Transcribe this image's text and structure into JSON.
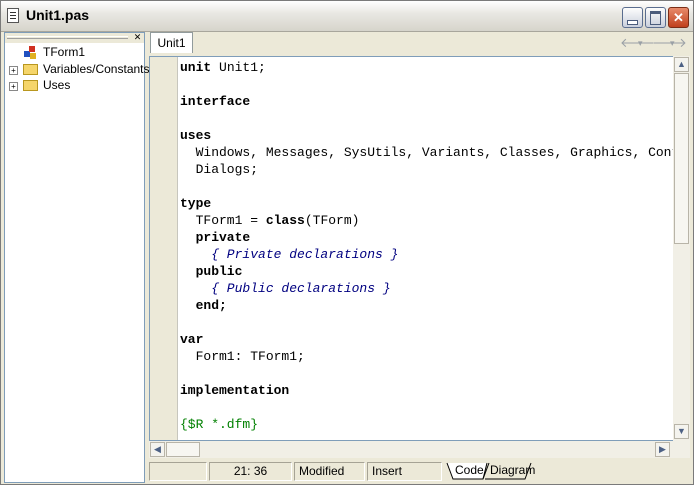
{
  "window": {
    "title": "Unit1.pas"
  },
  "tree": {
    "items": [
      {
        "label": "TForm1",
        "expandable": false,
        "icon": "form-icon"
      },
      {
        "label": "Variables/Constants",
        "expandable": true,
        "icon": "folder-icon"
      },
      {
        "label": "Uses",
        "expandable": true,
        "icon": "folder-icon"
      }
    ]
  },
  "editor": {
    "tab": "Unit1",
    "lines": [
      [
        {
          "t": "unit",
          "c": "kw"
        },
        {
          "t": " Unit1;",
          "c": ""
        }
      ],
      [],
      [
        {
          "t": "interface",
          "c": "kw"
        }
      ],
      [],
      [
        {
          "t": "uses",
          "c": "kw"
        }
      ],
      [
        {
          "t": "  Windows, Messages, SysUtils, Variants, Classes, Graphics, Controls, Forms,",
          "c": ""
        }
      ],
      [
        {
          "t": "  Dialogs;",
          "c": ""
        }
      ],
      [],
      [
        {
          "t": "type",
          "c": "kw"
        }
      ],
      [
        {
          "t": "  TForm1 = ",
          "c": ""
        },
        {
          "t": "class",
          "c": "kw"
        },
        {
          "t": "(TForm)",
          "c": ""
        }
      ],
      [
        {
          "t": "  private",
          "c": "kw"
        }
      ],
      [
        {
          "t": "    { Private declarations }",
          "c": "cm"
        }
      ],
      [
        {
          "t": "  public",
          "c": "kw"
        }
      ],
      [
        {
          "t": "    { Public declarations }",
          "c": "cm"
        }
      ],
      [
        {
          "t": "  end;",
          "c": "kw"
        }
      ],
      [],
      [
        {
          "t": "var",
          "c": "kw"
        }
      ],
      [
        {
          "t": "  Form1: TForm1;",
          "c": ""
        }
      ],
      [],
      [
        {
          "t": "implementation",
          "c": "kw"
        }
      ],
      [],
      [
        {
          "t": "{$R *.dfm}",
          "c": "dr"
        }
      ]
    ]
  },
  "status": {
    "position": "21:  36",
    "state": "Modified",
    "mode": "Insert",
    "tabs": [
      "Code",
      "Diagram"
    ]
  },
  "icons": {
    "back": "back-arrow-icon",
    "forward": "forward-arrow-icon",
    "close_panel": "close-icon"
  },
  "colors": {
    "keyword": "#000000",
    "comment": "#000080",
    "directive": "#008000"
  }
}
